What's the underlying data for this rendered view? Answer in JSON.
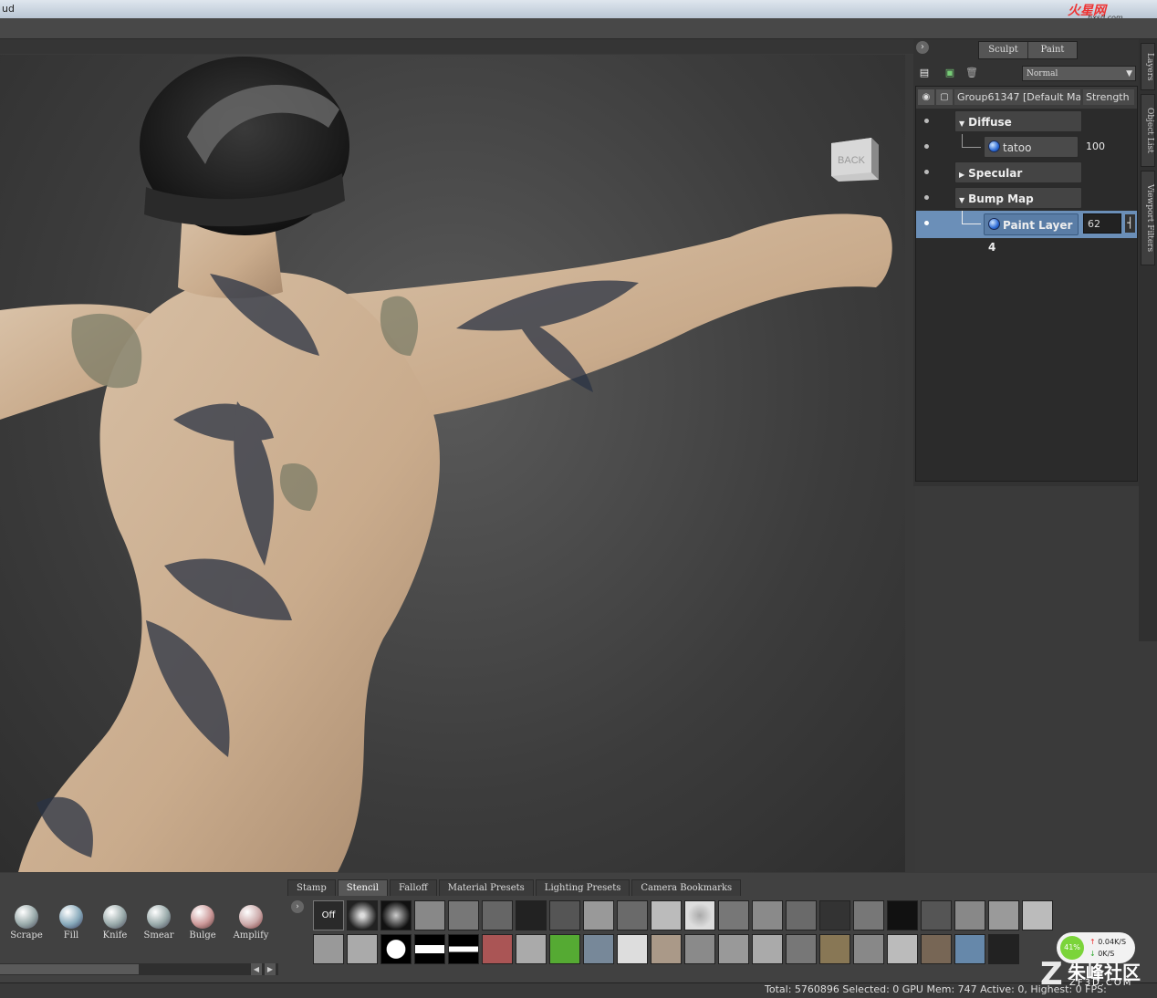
{
  "window": {
    "title_fragment": "ud"
  },
  "watermark_top": {
    "brand": "火星网",
    "url": "hxsd.com"
  },
  "viewport": {
    "nav_cube_label": "BACK"
  },
  "mode_buttons": [
    "Sculpt",
    "Paint"
  ],
  "layer_toolbar": {
    "blend_mode": "Normal"
  },
  "layers_header": {
    "name": "Group61347 [Default Ma",
    "column": "Strength"
  },
  "channels": [
    {
      "name": "Diffuse",
      "expanded": true
    },
    {
      "name": "Specular",
      "expanded": false
    },
    {
      "name": "Bump Map",
      "expanded": true
    }
  ],
  "paint_layers": [
    {
      "name": "tatoo",
      "strength": "100",
      "selected": false
    },
    {
      "name": "Paint Layer 4",
      "strength": "62",
      "selected": true
    }
  ],
  "side_tabs": [
    "Layers",
    "Object List",
    "Viewport Filters"
  ],
  "bottom_tabs": [
    "Stamp",
    "Stencil",
    "Falloff",
    "Material Presets",
    "Lighting Presets",
    "Camera Bookmarks"
  ],
  "active_bottom_tab": "Stencil",
  "brushes": [
    "Scrape",
    "Fill",
    "Knife",
    "Smear",
    "Bulge",
    "Amplify"
  ],
  "stencil_off_label": "Off",
  "status": {
    "text": "Total: 5760896  Selected: 0 GPU Mem: 747  Active: 0, Highest: 0  FPS:"
  },
  "net_widget": {
    "percent": "41%",
    "up": "0.04K/S",
    "down": "0K/S"
  },
  "watermark_bottom": {
    "chinese": "朱峰社区",
    "domain": "ZF3D.COM"
  },
  "colors": {
    "selected_row": "#6b8fb8",
    "panel_bg": "#2b2b2b",
    "viewport_bg": "#3c3c3c"
  }
}
